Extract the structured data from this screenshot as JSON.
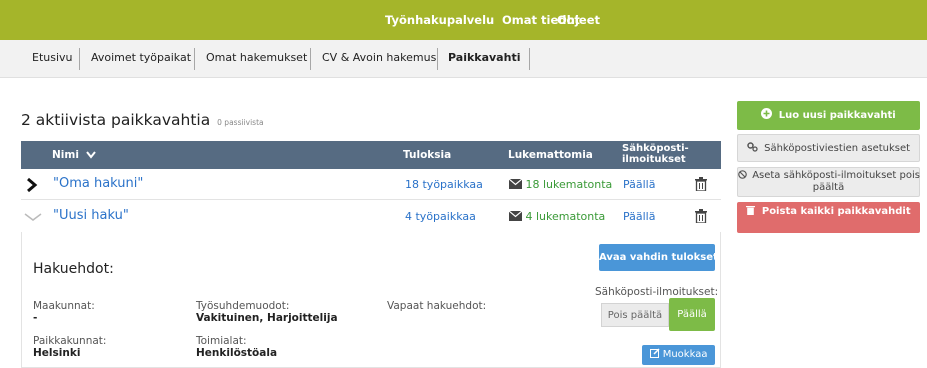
{
  "topnav": {
    "items": [
      "Työnhakupalvelu",
      "Omat tiedot",
      "Ohjeet"
    ]
  },
  "subnav": {
    "items": [
      "Etusivu",
      "Avoimet työpaikat",
      "Omat hakemukset",
      "CV & Avoin hakemus",
      "Paikkavahti"
    ]
  },
  "page": {
    "title": "2 aktiivista paikkavahtia",
    "passive": "0 passiivista"
  },
  "table": {
    "headers": {
      "name": "Nimi",
      "results": "Tuloksia",
      "unread": "Lukemattomia",
      "email_line1": "Sähköposti-",
      "email_line2": "ilmoitukset"
    },
    "rows": [
      {
        "name": "\"Oma hakuni\"",
        "results": "18 työpaikkaa",
        "unread": "18 lukematonta",
        "email": "Päällä"
      },
      {
        "name": "\"Uusi haku\"",
        "results": "4 työpaikkaa",
        "unread": "4 lukematonta",
        "email": "Päällä"
      }
    ]
  },
  "detail": {
    "heading": "Hakuehdot:",
    "open_results": "Avaa vahdin tulokset",
    "maakunnat_label": "Maakunnat:",
    "maakunnat_value": "-",
    "tyosuhde_label": "Työsuhdemuodot:",
    "tyosuhde_value": "Vakituinen, Harjoittelija",
    "vapaat_label": "Vapaat hakuehdot:",
    "email_label": "Sähköposti-ilmoitukset:",
    "toggle_off": "Pois päältä",
    "toggle_on": "Päällä",
    "paikkakunnat_label": "Paikkakunnat:",
    "paikkakunnat_value": "Helsinki",
    "toimialat_label": "Toimialat:",
    "toimialat_value": "Henkilöstöala",
    "edit": "Muokkaa"
  },
  "sidebar": {
    "create": "Luo uusi paikkavahti",
    "settings": "Sähköpostiviestien asetukset",
    "disable_line1": "Aseta sähköposti-ilmoitukset pois",
    "disable_line2": "päältä",
    "delete_all": "Poista kaikki paikkavahdit"
  },
  "colors": {
    "topbar": "#a5b52a",
    "table_header": "#566b82",
    "green": "#7dbb47",
    "red": "#e06c6c",
    "blue": "#4a96d8"
  },
  "icons": [
    "chevron-down-icon",
    "chevron-right-icon",
    "heart-icon",
    "envelope-icon",
    "trash-icon",
    "plus-circle-icon",
    "gears-icon",
    "ban-icon",
    "edit-icon"
  ]
}
